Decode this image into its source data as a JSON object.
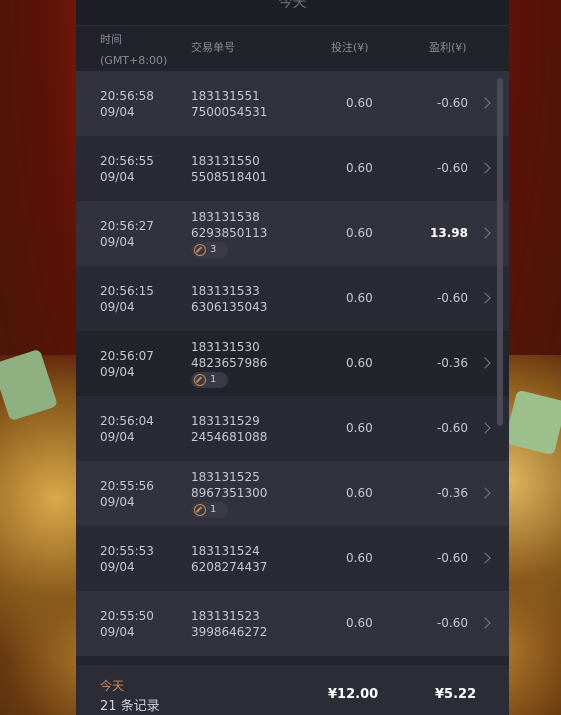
{
  "panel": {
    "title": "今天"
  },
  "columns": {
    "time": "时间",
    "timezone": "(GMT+8:00)",
    "id": "交易单号",
    "bet": "投注(¥)",
    "profit": "盈利(¥)"
  },
  "rows": [
    {
      "time": "20:56:58",
      "date": "09/04",
      "id1": "183131551",
      "id2": "7500054531",
      "bet": "0.60",
      "profit": "-0.60",
      "badge": null
    },
    {
      "time": "20:56:55",
      "date": "09/04",
      "id1": "183131550",
      "id2": "5508518401",
      "bet": "0.60",
      "profit": "-0.60",
      "badge": null
    },
    {
      "time": "20:56:27",
      "date": "09/04",
      "id1": "183131538",
      "id2": "6293850113",
      "bet": "0.60",
      "profit": "13.98",
      "badge": "3"
    },
    {
      "time": "20:56:15",
      "date": "09/04",
      "id1": "183131533",
      "id2": "6306135043",
      "bet": "0.60",
      "profit": "-0.60",
      "badge": null
    },
    {
      "time": "20:56:07",
      "date": "09/04",
      "id1": "183131530",
      "id2": "4823657986",
      "bet": "0.60",
      "profit": "-0.36",
      "badge": "1"
    },
    {
      "time": "20:56:04",
      "date": "09/04",
      "id1": "183131529",
      "id2": "2454681088",
      "bet": "0.60",
      "profit": "-0.60",
      "badge": null
    },
    {
      "time": "20:55:56",
      "date": "09/04",
      "id1": "183131525",
      "id2": "8967351300",
      "bet": "0.60",
      "profit": "-0.36",
      "badge": "1"
    },
    {
      "time": "20:55:53",
      "date": "09/04",
      "id1": "183131524",
      "id2": "6208274437",
      "bet": "0.60",
      "profit": "-0.60",
      "badge": null
    },
    {
      "time": "20:55:50",
      "date": "09/04",
      "id1": "183131523",
      "id2": "3998646272",
      "bet": "0.60",
      "profit": "-0.60",
      "badge": null
    }
  ],
  "footer": {
    "label": "今天",
    "count": "21 条记录",
    "total_bet": "¥12.00",
    "total_profit": "¥5.22"
  },
  "icons": {
    "row_arrow": "chevron-right-icon",
    "badge": "free-spin-icon"
  }
}
